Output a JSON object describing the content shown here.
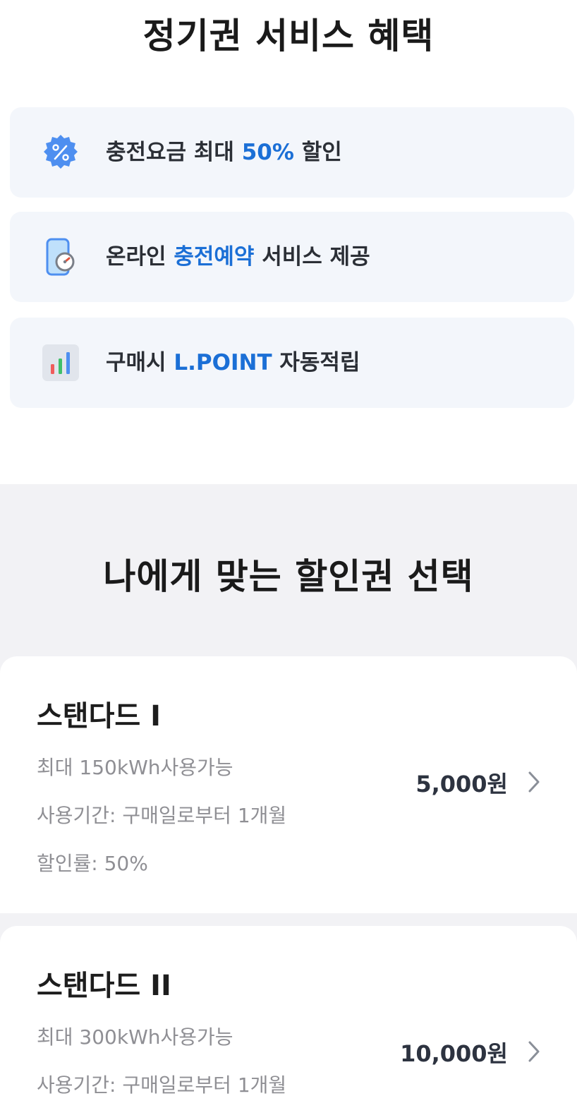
{
  "benefits": {
    "title": "정기권 서비스 혜택",
    "items": [
      {
        "icon": "percent-badge-icon",
        "pre": "충전요금 최대 ",
        "highlight": "50%",
        "post": " 할인"
      },
      {
        "icon": "phone-gauge-icon",
        "pre": "온라인 ",
        "highlight": "충전예약",
        "post": " 서비스 제공"
      },
      {
        "icon": "bar-chart-icon",
        "pre": "구매시 ",
        "highlight": "L.POINT",
        "post": " 자동적립"
      }
    ]
  },
  "plans": {
    "title": "나에게 맞는 할인권 선택",
    "items": [
      {
        "name": "스탠다드 I",
        "line1": "최대 150kWh사용가능",
        "line2": "사용기간: 구매일로부터 1개월",
        "line3": "할인률: 50%",
        "price": "5,000원"
      },
      {
        "name": "스탠다드 II",
        "line1": "최대 300kWh사용가능",
        "line2": "사용기간: 구매일로부터 1개월",
        "price": "10,000원"
      }
    ]
  },
  "colors": {
    "highlight": "#1b6fd6",
    "card_bg": "#f3f6fb",
    "section_bg": "#f2f2f5"
  }
}
